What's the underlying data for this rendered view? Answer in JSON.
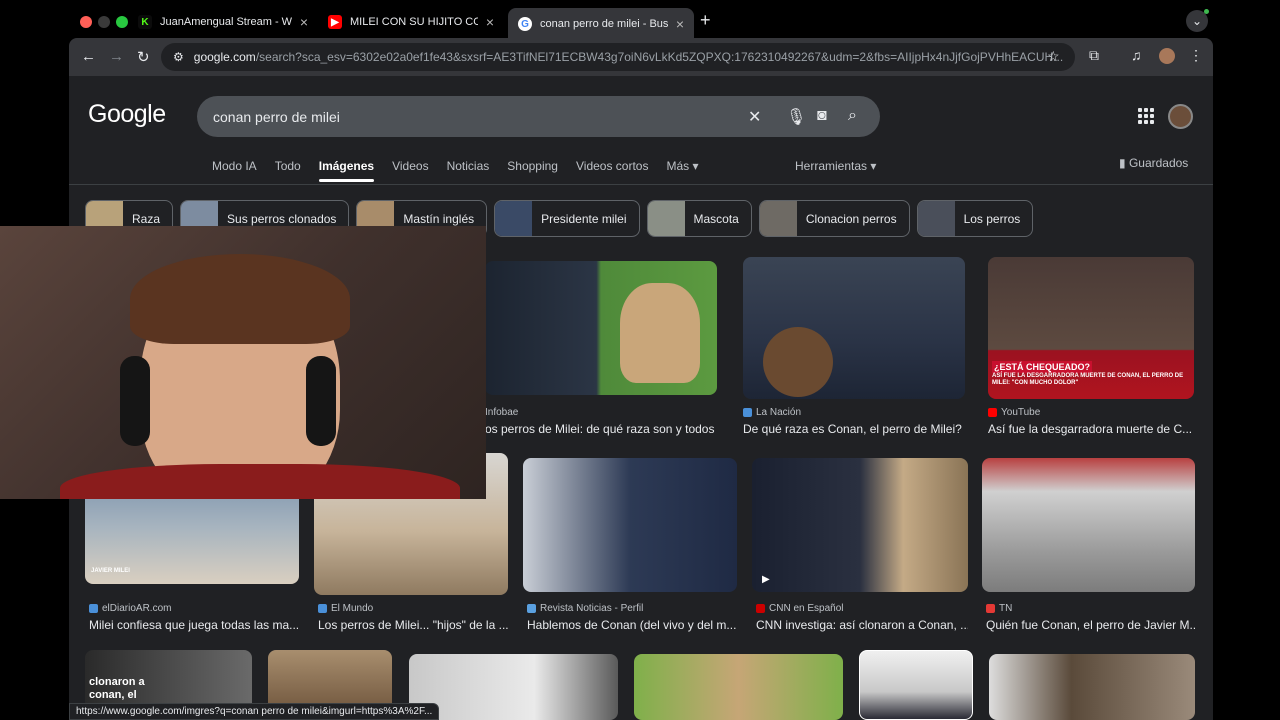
{
  "browser": {
    "tabs": [
      {
        "title": "JuanAmengual Stream - Wat",
        "icon": "kick-icon",
        "color": "#53fc18"
      },
      {
        "title": "MILEI CON SU HIJITO CO",
        "icon": "youtube-icon",
        "color": "#ff0000"
      },
      {
        "title": "conan perro de milei - Buscar",
        "icon": "google-icon",
        "color": "#ffffff"
      }
    ],
    "url_host": "google.com",
    "url_rest": "/search?sca_esv=6302e02a0ef1fe43&sxsrf=AE3TifNEl71ECBW43g7oiN6vLkKd5ZQPXQ:1762310492267&udm=2&fbs=AIIjpHx4nJjfGojPVHhEACUH..."
  },
  "google": {
    "logo": "Google",
    "query": "conan perro de milei",
    "nav_tabs": [
      "Modo IA",
      "Todo",
      "Imágenes",
      "Videos",
      "Noticias",
      "Shopping",
      "Videos cortos",
      "Más ▾"
    ],
    "selected_tab": "Imágenes",
    "tools_label": "Herramientas ▾",
    "saved_label": "Guardados",
    "chips": [
      "Raza",
      "Sus perros clonados",
      "Mastín inglés",
      "Presidente milei",
      "Mascota",
      "Clonacion perros",
      "Los perros"
    ]
  },
  "results": [
    {
      "source": "Infobae",
      "caption": "os perros de Milei: de qué raza son y todos l...",
      "favicon": "#f3a800"
    },
    {
      "source": "La Nación",
      "caption": "De qué raza es Conan, el perro de Milei? ...",
      "favicon": "#4a90d9"
    },
    {
      "source": "YouTube",
      "caption": "Así fue la desgarradora muerte de C...",
      "favicon": "#ff0000"
    },
    {
      "source": "elDiarioAR.com",
      "caption": "Milei confiesa que juega todas las ma...",
      "favicon": "#4a90d9"
    },
    {
      "source": "El Mundo",
      "caption": "Los perros de Milei... \"hijos\" de la ...",
      "favicon": "#4a90d9"
    },
    {
      "source": "Revista Noticias - Perfil",
      "caption": "Hablemos de Conan (del vivo y del m...",
      "favicon": "#5aa0e0"
    },
    {
      "source": "CNN en Español",
      "caption": "CNN investiga: así clonaron a Conan, ...",
      "favicon": "#cc0000"
    },
    {
      "source": "TN",
      "caption": "Quién fue Conan, el perro de Javier M...",
      "favicon": "#e53935"
    }
  ],
  "overlay_texts": {
    "chequeado": "¿ESTÁ CHEQUEADO?",
    "chequeado_sub": "ASÍ FUE LA DESGARRADORA MUERTE DE CONAN, EL PERRO DE MILEI: \"CON MUCHO DOLOR\"",
    "clonaron": "clonaron a conan, el perro",
    "javier": "JAVIER MILEI"
  },
  "status_url": "https://www.google.com/imgres?q=conan perro de milei&imgurl=https%3A%2F..."
}
